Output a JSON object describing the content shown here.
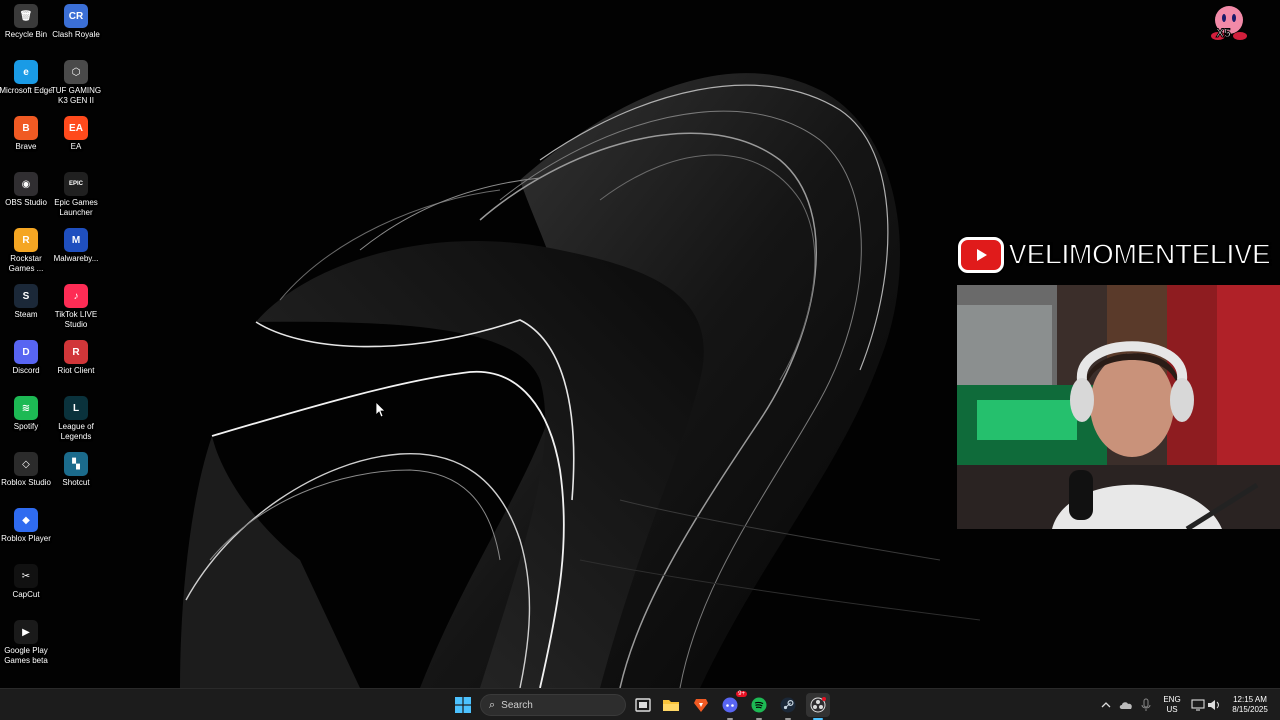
{
  "desktop_icons": [
    {
      "label": "Recycle Bin",
      "icon": "recycle-bin-icon",
      "color": "#3a3a3a",
      "glyph": "🗑"
    },
    {
      "label": "Clash Royale",
      "icon": "clash-royale-icon",
      "color": "#3b6fd6",
      "glyph": "CR"
    },
    {
      "label": "Microsoft Edge",
      "icon": "edge-icon",
      "color": "#1a9be6",
      "glyph": "e"
    },
    {
      "label": "TUF GAMING K3 GEN II",
      "icon": "tuf-gaming-icon",
      "color": "#4a4a4a",
      "glyph": "⬡"
    },
    {
      "label": "Brave",
      "icon": "brave-icon",
      "color": "#f05a23",
      "glyph": "B"
    },
    {
      "label": "EA",
      "icon": "ea-icon",
      "color": "#ff4a1c",
      "glyph": "EA"
    },
    {
      "label": "OBS Studio",
      "icon": "obs-icon",
      "color": "#302e31",
      "glyph": "◉"
    },
    {
      "label": "Epic Games Launcher",
      "icon": "epic-games-icon",
      "color": "#202020",
      "glyph": "EPIC"
    },
    {
      "label": "Rockstar Games ...",
      "icon": "rockstar-icon",
      "color": "#f5a623",
      "glyph": "R"
    },
    {
      "label": "Malwareby...",
      "icon": "malwarebytes-icon",
      "color": "#1f4fbf",
      "glyph": "M"
    },
    {
      "label": "Steam",
      "icon": "steam-icon",
      "color": "#1b2838",
      "glyph": "S"
    },
    {
      "label": "TikTok LIVE Studio",
      "icon": "tiktok-icon",
      "color": "#fe2c55",
      "glyph": "♪"
    },
    {
      "label": "Discord",
      "icon": "discord-icon",
      "color": "#5865f2",
      "glyph": "D"
    },
    {
      "label": "Riot Client",
      "icon": "riot-client-icon",
      "color": "#d13639",
      "glyph": "R"
    },
    {
      "label": "Spotify",
      "icon": "spotify-icon",
      "color": "#1db954",
      "glyph": "≋"
    },
    {
      "label": "League of Legends",
      "icon": "league-of-legends-icon",
      "color": "#0a323c",
      "glyph": "L"
    },
    {
      "label": "Roblox Studio",
      "icon": "roblox-studio-icon",
      "color": "#2b2b2b",
      "glyph": "◇"
    },
    {
      "label": "Shotcut",
      "icon": "shotcut-icon",
      "color": "#1b6b8c",
      "glyph": "▚"
    },
    {
      "label": "Roblox Player",
      "icon": "roblox-player-icon",
      "color": "#2f6bf0",
      "glyph": "◆"
    },
    {
      "label": "CapCut",
      "icon": "capcut-icon",
      "color": "#111111",
      "glyph": "✂"
    },
    {
      "label": "Google Play Games beta",
      "icon": "google-play-games-icon",
      "color": "#1a1a1a",
      "glyph": "▶"
    }
  ],
  "overlay": {
    "channel_name": "VELIMOMENTELIVE",
    "kirby_label": "X5"
  },
  "taskbar": {
    "search_placeholder": "Search",
    "language": "ENG",
    "region": "US",
    "time": "12:15 AM",
    "date": "8/15/2025",
    "discord_badge": "9+"
  },
  "colors": {
    "taskbar_bg": "#1c1c1c",
    "youtube_red": "#e01b1b",
    "windows_blue": "#4cc2ff"
  }
}
